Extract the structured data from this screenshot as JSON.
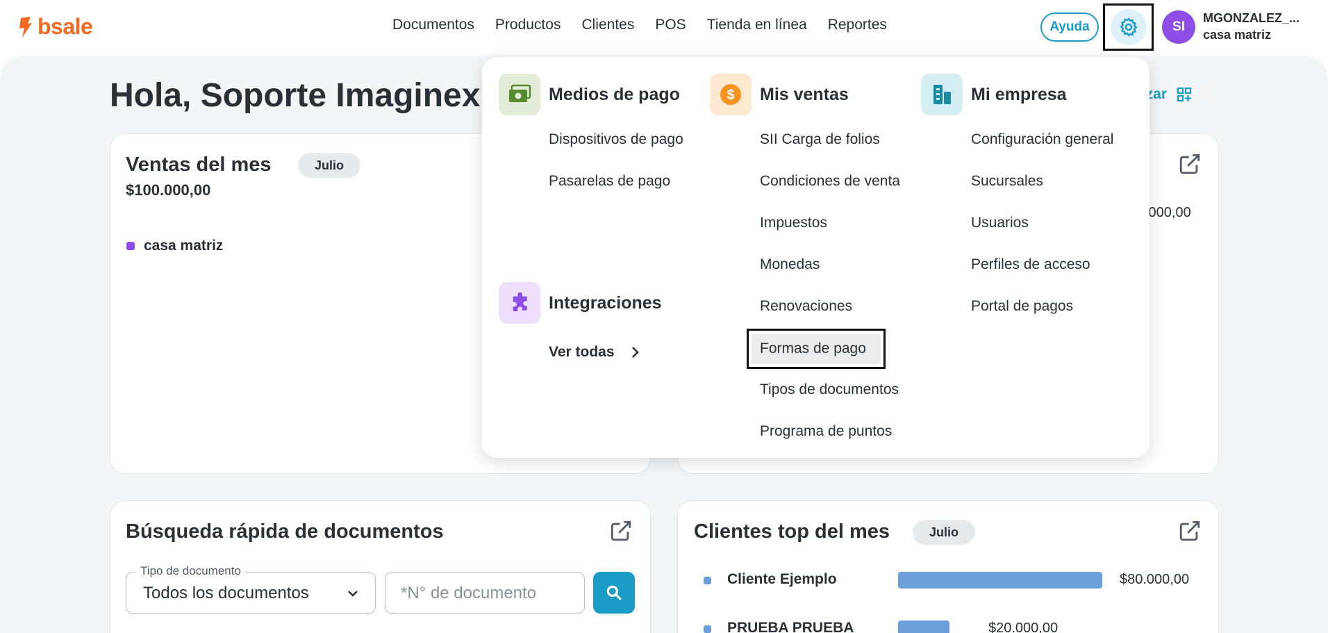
{
  "header": {
    "logo_text": "bsale",
    "nav": [
      "Documentos",
      "Productos",
      "Clientes",
      "POS",
      "Tienda en línea",
      "Reportes"
    ],
    "help_label": "Ayuda",
    "avatar_initials": "SI",
    "user_name": "MGONZALEZ_...",
    "user_branch": "casa matriz"
  },
  "colors": {
    "brand": "#f26a21",
    "accent": "#1a9cc7",
    "avatar": "#8e4de6",
    "bar": "#6b9fd9"
  },
  "greeting": "Hola, Soporte Imaginex",
  "customize_label": "lizar",
  "sales_card": {
    "title": "Ventas del mes",
    "month_chip": "Julio",
    "amount": "$100.000,00",
    "legend_label": "casa matriz"
  },
  "right_card": {
    "amount_partial": ".000,00"
  },
  "search_card": {
    "title": "Búsqueda rápida de documentos",
    "doc_type_legend": "Tipo de documento",
    "doc_type_value": "Todos los documentos",
    "doc_number_placeholder": "*N° de documento"
  },
  "clients_card": {
    "title": "Clientes top del mes",
    "month_chip": "Julio",
    "rows": [
      {
        "name": "Cliente Ejemplo",
        "amount": "$80.000,00",
        "value": 80000
      },
      {
        "name": "PRUEBA PRUEBA",
        "amount": "$20.000,00",
        "value": 20000
      }
    ]
  },
  "menu": {
    "medios_de_pago": {
      "title": "Medios de pago",
      "icon": "money-icon",
      "items": [
        "Dispositivos de pago",
        "Pasarelas de pago"
      ]
    },
    "integraciones": {
      "title": "Integraciones",
      "icon": "puzzle-icon",
      "see_all": "Ver todas"
    },
    "mis_ventas": {
      "title": "Mis ventas",
      "icon": "dollar-coin-icon",
      "items": [
        "SII Carga de folios",
        "Condiciones de venta",
        "Impuestos",
        "Monedas",
        "Renovaciones",
        "Formas de pago",
        "Tipos de documentos",
        "Programa de puntos"
      ]
    },
    "mi_empresa": {
      "title": "Mi empresa",
      "icon": "building-icon",
      "items": [
        "Configuración general",
        "Sucursales",
        "Usuarios",
        "Perfiles de acceso",
        "Portal de pagos"
      ]
    }
  }
}
